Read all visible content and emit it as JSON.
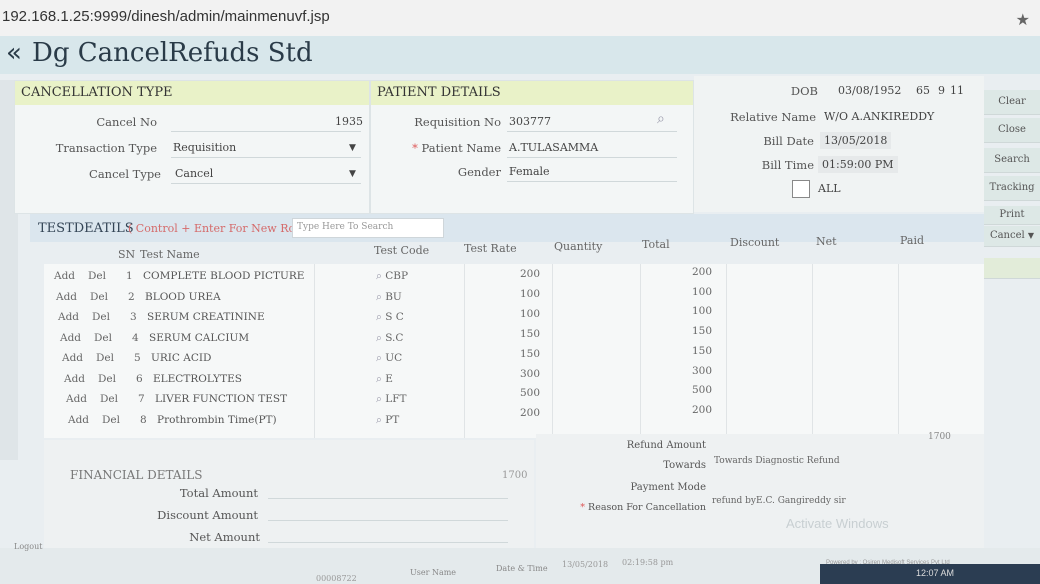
{
  "browser": {
    "url": "192.168.1.25:9999/dinesh/admin/mainmenuvf.jsp"
  },
  "header": {
    "title": "Dg CancelRefuds Std",
    "back_icon": "«"
  },
  "cancellation": {
    "heading": "CANCELLATION TYPE",
    "cancel_no_label": "Cancel No",
    "cancel_no": "1935",
    "transaction_type_label": "Transaction Type",
    "transaction_type": "Requisition",
    "cancel_type_label": "Cancel Type",
    "cancel_type": "Cancel"
  },
  "patient": {
    "heading": "PATIENT DETAILS",
    "requisition_no_label": "Requisition No",
    "requisition_no": "303777",
    "patient_name_label": "Patient Name",
    "patient_name": "A.TULASAMMA",
    "gender_label": "Gender",
    "gender": "Female"
  },
  "right_info": {
    "dob_label": "DOB",
    "dob": "03/08/1952",
    "age_y": "65",
    "age_m": "9",
    "age_d": "11",
    "relative_label": "Relative Name",
    "relative": "W/O A.ANKIREDDY",
    "bill_date_label": "Bill Date",
    "bill_date": "13/05/2018",
    "bill_time_label": "Bill Time",
    "bill_time": "01:59:00 PM",
    "all_label": "ALL"
  },
  "side_buttons": {
    "clear": "Clear",
    "close": "Close",
    "search": "Search",
    "tracking": "Tracking",
    "print": "Print",
    "print_option": "Cancel"
  },
  "tests": {
    "heading": "TESTDEATILS",
    "hint": "( Control + Enter For New Row )",
    "search_placeholder": "Type Here To Search",
    "columns": {
      "sn": "SN",
      "name": "Test Name",
      "code": "Test Code",
      "rate": "Test Rate",
      "qty": "Quantity",
      "total": "Total",
      "discount": "Discount",
      "net": "Net",
      "paid": "Paid"
    },
    "add_label": "Add",
    "del_label": "Del",
    "rows": [
      {
        "sn": "1",
        "name": "COMPLETE BLOOD PICTURE",
        "code": "CBP",
        "rate": "200",
        "total": "200"
      },
      {
        "sn": "2",
        "name": "BLOOD UREA",
        "code": "BU",
        "rate": "100",
        "total": "100"
      },
      {
        "sn": "3",
        "name": "SERUM CREATININE",
        "code": "S C",
        "rate": "100",
        "total": "100"
      },
      {
        "sn": "4",
        "name": "SERUM CALCIUM",
        "code": "S.C",
        "rate": "150",
        "total": "150"
      },
      {
        "sn": "5",
        "name": "URIC ACID",
        "code": "UC",
        "rate": "150",
        "total": "150"
      },
      {
        "sn": "6",
        "name": "ELECTROLYTES",
        "code": "E",
        "rate": "300",
        "total": "300"
      },
      {
        "sn": "7",
        "name": "LIVER FUNCTION TEST",
        "code": "LFT",
        "rate": "500",
        "total": "500"
      },
      {
        "sn": "8",
        "name": "Prothrombin Time(PT)",
        "code": "PT",
        "rate": "200",
        "total": "200"
      }
    ]
  },
  "financial": {
    "heading": "FINANCIAL DETAILS",
    "total_label": "Total Amount",
    "total": "1700",
    "discount_label": "Discount Amount",
    "net_label": "Net Amount"
  },
  "refund": {
    "refund_amount_label": "Refund Amount",
    "refund_amount": "1700",
    "towards_label": "Towards",
    "towards": "Towards Diagnostic Refund",
    "payment_mode_label": "Payment Mode",
    "reason_label": "Reason For Cancellation",
    "reason": "refund byE.C. Gangireddy sir"
  },
  "footer": {
    "logout": "Logout",
    "user_name_label": "User Name",
    "date_time_label": "Date & Time",
    "date": "13/05/2018",
    "time": "02:19:58 pm",
    "code": "00008722",
    "powered": "Powered by : Osiren Medisoft Services Pvt Ltd",
    "watermark": "Activate Windows",
    "clock": "12:07 AM"
  }
}
